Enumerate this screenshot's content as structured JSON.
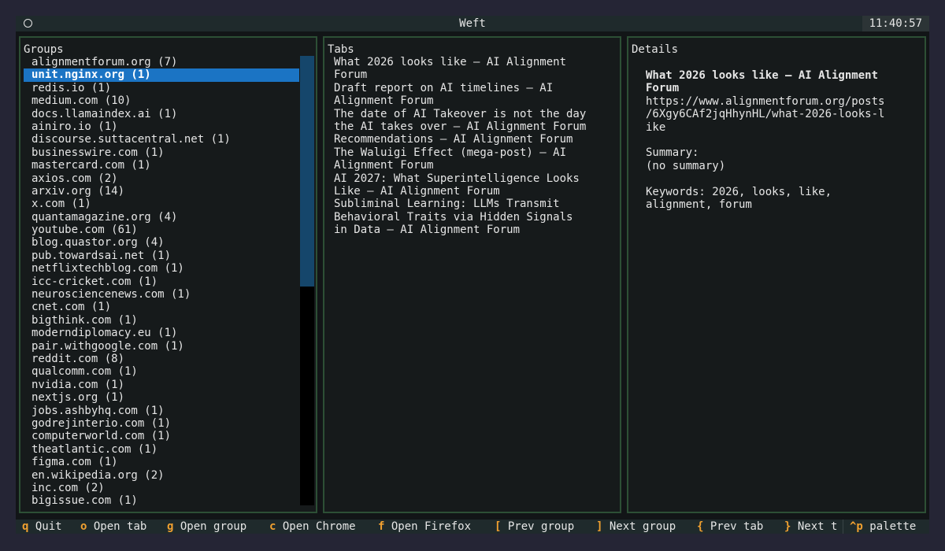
{
  "window": {
    "title": "Weft",
    "clock": "11:40:57"
  },
  "groups": {
    "title": "Groups",
    "items": [
      "alignmentforum.org (7)",
      "unit.nginx.org (1)",
      "redis.io (1)",
      "medium.com (10)",
      "docs.llamaindex.ai (1)",
      "ainiro.io (1)",
      "discourse.suttacentral.net (1)",
      "businesswire.com (1)",
      "mastercard.com (1)",
      "axios.com (2)",
      "arxiv.org (14)",
      "x.com (1)",
      "quantamagazine.org (4)",
      "youtube.com (61)",
      "blog.quastor.org (4)",
      "pub.towardsai.net (1)",
      "netflixtechblog.com (1)",
      "icc-cricket.com (1)",
      "neurosciencenews.com (1)",
      "cnet.com (1)",
      "bigthink.com (1)",
      "moderndiplomacy.eu (1)",
      "pair.withgoogle.com (1)",
      "reddit.com (8)",
      "qualcomm.com (1)",
      "nvidia.com (1)",
      "nextjs.org (1)",
      "jobs.ashbyhq.com (1)",
      "godrejinterio.com (1)",
      "computerworld.com (1)",
      "theatlantic.com (1)",
      "figma.com (1)",
      "en.wikipedia.org (2)",
      "inc.com (2)",
      "bigissue.com (1)"
    ],
    "selected_index": 1
  },
  "tabs": {
    "title": "Tabs",
    "lines": [
      "What 2026 looks like — AI Alignment",
      "Forum",
      "Draft report on AI timelines — AI",
      "Alignment Forum",
      "The date of AI Takeover is not the day",
      "the AI takes over — AI Alignment Forum",
      "Recommendations — AI Alignment Forum",
      "The Waluigi Effect (mega-post) — AI",
      "Alignment Forum",
      "AI 2027: What Superintelligence Looks",
      "Like — AI Alignment Forum",
      "Subliminal Learning: LLMs Transmit",
      "Behavioral Traits via Hidden Signals",
      "in Data — AI Alignment Forum"
    ]
  },
  "details": {
    "title": "Details",
    "heading_lines": [
      "What 2026 looks like — AI Alignment",
      "Forum"
    ],
    "url_lines": [
      "https://www.alignmentforum.org/posts",
      "/6Xgy6CAf2jqHhynHL/what-2026-looks-l",
      "ike"
    ],
    "summary_label": "Summary:",
    "summary_value": "(no summary)",
    "keywords_lines": [
      "Keywords: 2026, looks, like,",
      "alignment, forum"
    ]
  },
  "statusbar": {
    "items": [
      {
        "key": "q",
        "label": "Quit"
      },
      {
        "key": "o",
        "label": "Open tab"
      },
      {
        "key": "g",
        "label": "Open group"
      },
      {
        "key": "c",
        "label": "Open Chrome"
      },
      {
        "key": "f",
        "label": "Open Firefox"
      },
      {
        "key": "[",
        "label": "Prev group"
      },
      {
        "key": "]",
        "label": "Next group"
      },
      {
        "key": "{",
        "label": "Prev tab"
      },
      {
        "key": "}",
        "label": "Next t"
      }
    ],
    "palette": {
      "key": "^p",
      "label": "palette"
    }
  }
}
